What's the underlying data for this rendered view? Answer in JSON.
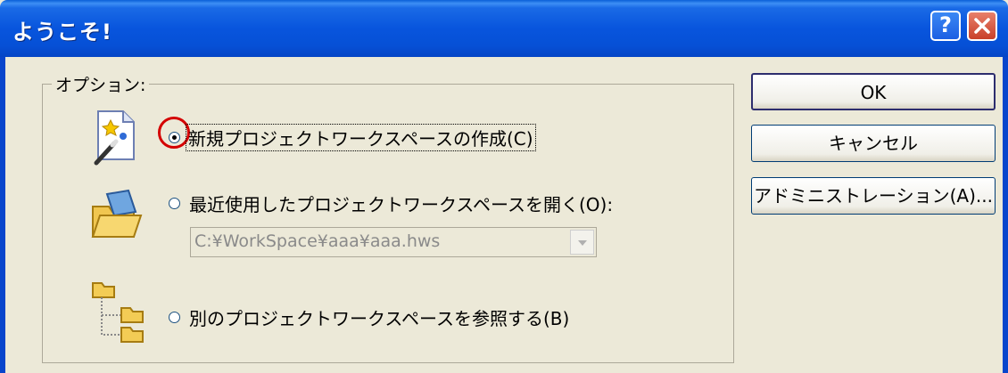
{
  "window": {
    "title": "ようこそ!",
    "help_label": "?",
    "close_label": "✕"
  },
  "options_group": {
    "legend": "オプション:",
    "options": [
      {
        "label": "新規プロジェクトワークスペースの作成(C)",
        "selected": true,
        "icon": "new-workspace-wand-icon"
      },
      {
        "label": "最近使用したプロジェクトワークスペースを開く(O):",
        "selected": false,
        "icon": "open-folder-icon"
      },
      {
        "label": "別のプロジェクトワークスペースを参照する(B)",
        "selected": false,
        "icon": "folder-tree-icon"
      }
    ],
    "recent_combo": {
      "value": "C:¥WorkSpace¥aaa¥aaa.hws",
      "disabled": true
    }
  },
  "buttons": {
    "ok": "OK",
    "cancel": "キャンセル",
    "admin": "アドミニストレーション(A)..."
  },
  "colors": {
    "titlebar": "#0855dd",
    "dialog_bg": "#ece9d8",
    "focus_ring": "#d40000"
  }
}
